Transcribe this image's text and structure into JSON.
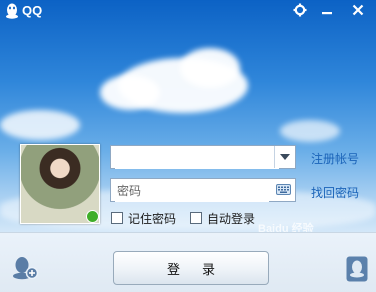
{
  "window": {
    "title": "QQ"
  },
  "controls": {
    "settings_icon": "gear-icon",
    "minimize_icon": "minimize-icon",
    "close_icon": "close-icon"
  },
  "login_form": {
    "account": {
      "value": "",
      "placeholder": ""
    },
    "password": {
      "value": "",
      "placeholder": "密码"
    },
    "register_link": "注册帐号",
    "find_password_link": "找回密码",
    "remember_password": {
      "label": "记住密码",
      "checked": false
    },
    "auto_login": {
      "label": "自动登录",
      "checked": false
    },
    "login_button": "登录"
  },
  "status": {
    "online": true
  },
  "watermark": "Baidu 经验"
}
